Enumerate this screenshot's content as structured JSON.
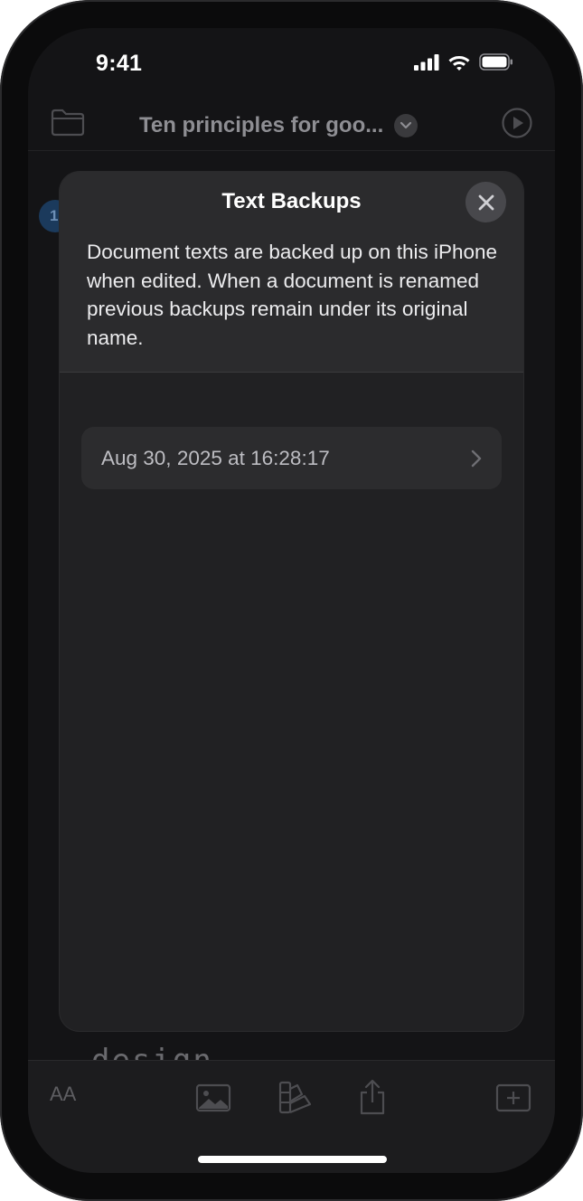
{
  "status_bar": {
    "time": "9:41"
  },
  "app_toolbar": {
    "document_title": "Ten principles for goo..."
  },
  "background_doc": {
    "badge": "1",
    "text_tail": "design"
  },
  "bottom_toolbar": {
    "text_size_label": "AA"
  },
  "sheet": {
    "title": "Text Backups",
    "description": "Document texts are backed up on this iPhone when edited. When a document is renamed previous backups remain under its original name.",
    "backups": [
      {
        "label": "Aug 30, 2025 at 16:28:17"
      }
    ]
  },
  "colors": {
    "background": "#141416",
    "sheet": "#212123",
    "sheet_header": "#2b2b2d",
    "row": "#2c2c2e",
    "accent_badge": "#1b3a5c"
  }
}
